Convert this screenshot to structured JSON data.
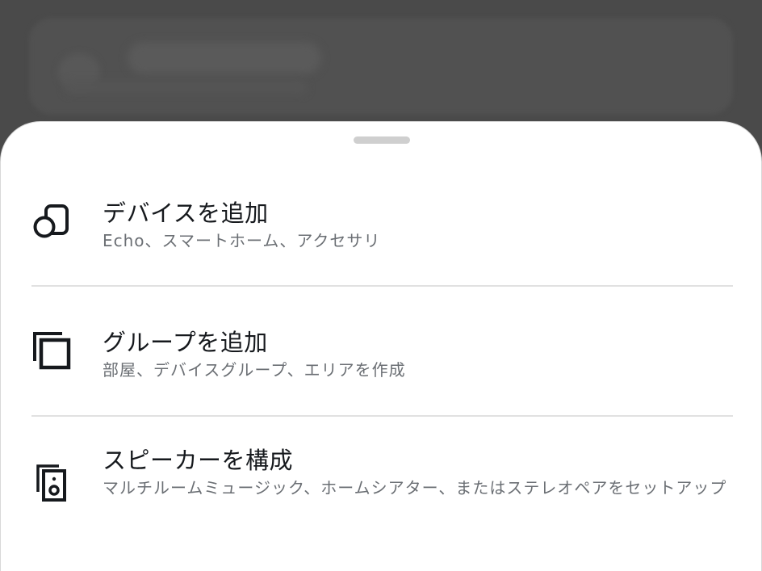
{
  "sheet": {
    "items": [
      {
        "title": "デバイスを追加",
        "subtitle": "Echo、スマートホーム、アクセサリ",
        "icon": "devices-shapes-icon"
      },
      {
        "title": "グループを追加",
        "subtitle": "部屋、デバイスグループ、エリアを作成",
        "icon": "stacked-squares-icon"
      },
      {
        "title": "スピーカーを構成",
        "subtitle": "マルチルームミュージック、ホームシアター、またはステレオペアをセットアップ",
        "icon": "speaker-icon"
      }
    ]
  },
  "colors": {
    "backdrop": "#4a4a4a",
    "sheet": "#ffffff",
    "title": "#16191d",
    "subtitle": "#6b6f74",
    "divider": "#e1e1e1",
    "handle": "#cfcfcf"
  }
}
